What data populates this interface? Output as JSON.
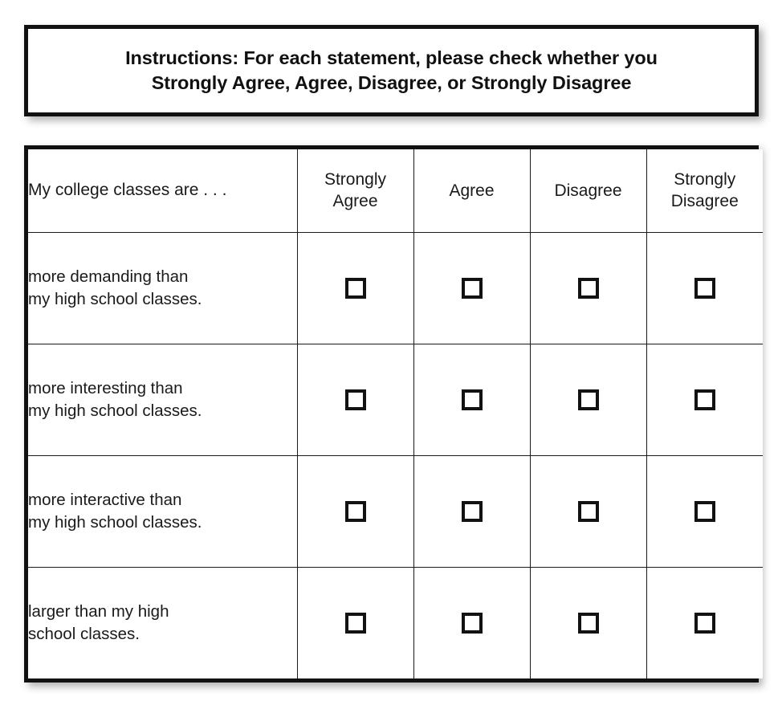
{
  "instructions": {
    "line1": "Instructions: For each statement, please check whether you",
    "line2": "Strongly Agree, Agree, Disagree, or Strongly Disagree"
  },
  "table": {
    "header": {
      "statement_column": "My college classes are . . .",
      "options": [
        {
          "line1": "Strongly",
          "line2": "Agree"
        },
        {
          "line1": "Agree",
          "line2": ""
        },
        {
          "line1": "Disagree",
          "line2": ""
        },
        {
          "line1": "Strongly",
          "line2": "Disagree"
        }
      ]
    },
    "rows": [
      {
        "statement_line1": "more demanding than",
        "statement_line2": "my high school classes.",
        "choices": [
          {
            "option": "Strongly Agree",
            "checked": false
          },
          {
            "option": "Agree",
            "checked": false
          },
          {
            "option": "Disagree",
            "checked": false
          },
          {
            "option": "Strongly Disagree",
            "checked": false
          }
        ]
      },
      {
        "statement_line1": "more interesting than",
        "statement_line2": "my high school classes.",
        "choices": [
          {
            "option": "Strongly Agree",
            "checked": false
          },
          {
            "option": "Agree",
            "checked": false
          },
          {
            "option": "Disagree",
            "checked": false
          },
          {
            "option": "Strongly Disagree",
            "checked": false
          }
        ]
      },
      {
        "statement_line1": "more interactive than",
        "statement_line2": "my high school classes.",
        "choices": [
          {
            "option": "Strongly Agree",
            "checked": false
          },
          {
            "option": "Agree",
            "checked": false
          },
          {
            "option": "Disagree",
            "checked": false
          },
          {
            "option": "Strongly Disagree",
            "checked": false
          }
        ]
      },
      {
        "statement_line1": "larger than my high",
        "statement_line2": "school classes.",
        "choices": [
          {
            "option": "Strongly Agree",
            "checked": false
          },
          {
            "option": "Agree",
            "checked": false
          },
          {
            "option": "Disagree",
            "checked": false
          },
          {
            "option": "Strongly Disagree",
            "checked": false
          }
        ]
      }
    ]
  },
  "colors": {
    "border": "#111111",
    "text": "#1a1a1a",
    "background": "#ffffff"
  }
}
